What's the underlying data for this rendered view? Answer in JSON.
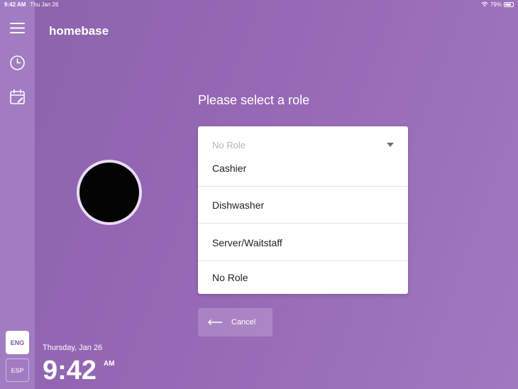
{
  "status_bar": {
    "time": "9:42 AM",
    "date": "Thu Jan 26",
    "battery": "79%",
    "battery_level": 0.79
  },
  "sidebar": {
    "icons": [
      "hamburger-menu-icon",
      "clock-icon",
      "calendar-icon"
    ],
    "languages": [
      {
        "label": "ENG",
        "selected": true
      },
      {
        "label": "ESP",
        "selected": false
      }
    ]
  },
  "brand": "homebase",
  "role_prompt": "Please select a role",
  "dropdown": {
    "selected_value": "No Role",
    "options": [
      "Cashier",
      "Dishwasher",
      "Server/Waitstaff",
      "No Role"
    ]
  },
  "cancel_label": "Cancel",
  "footer": {
    "date": "Thursday, Jan 26",
    "time": "9:42",
    "ampm": "AM"
  },
  "colors": {
    "background": "#9668b5",
    "sidebar": "#a17cc2",
    "accent": "#7e57a3"
  }
}
